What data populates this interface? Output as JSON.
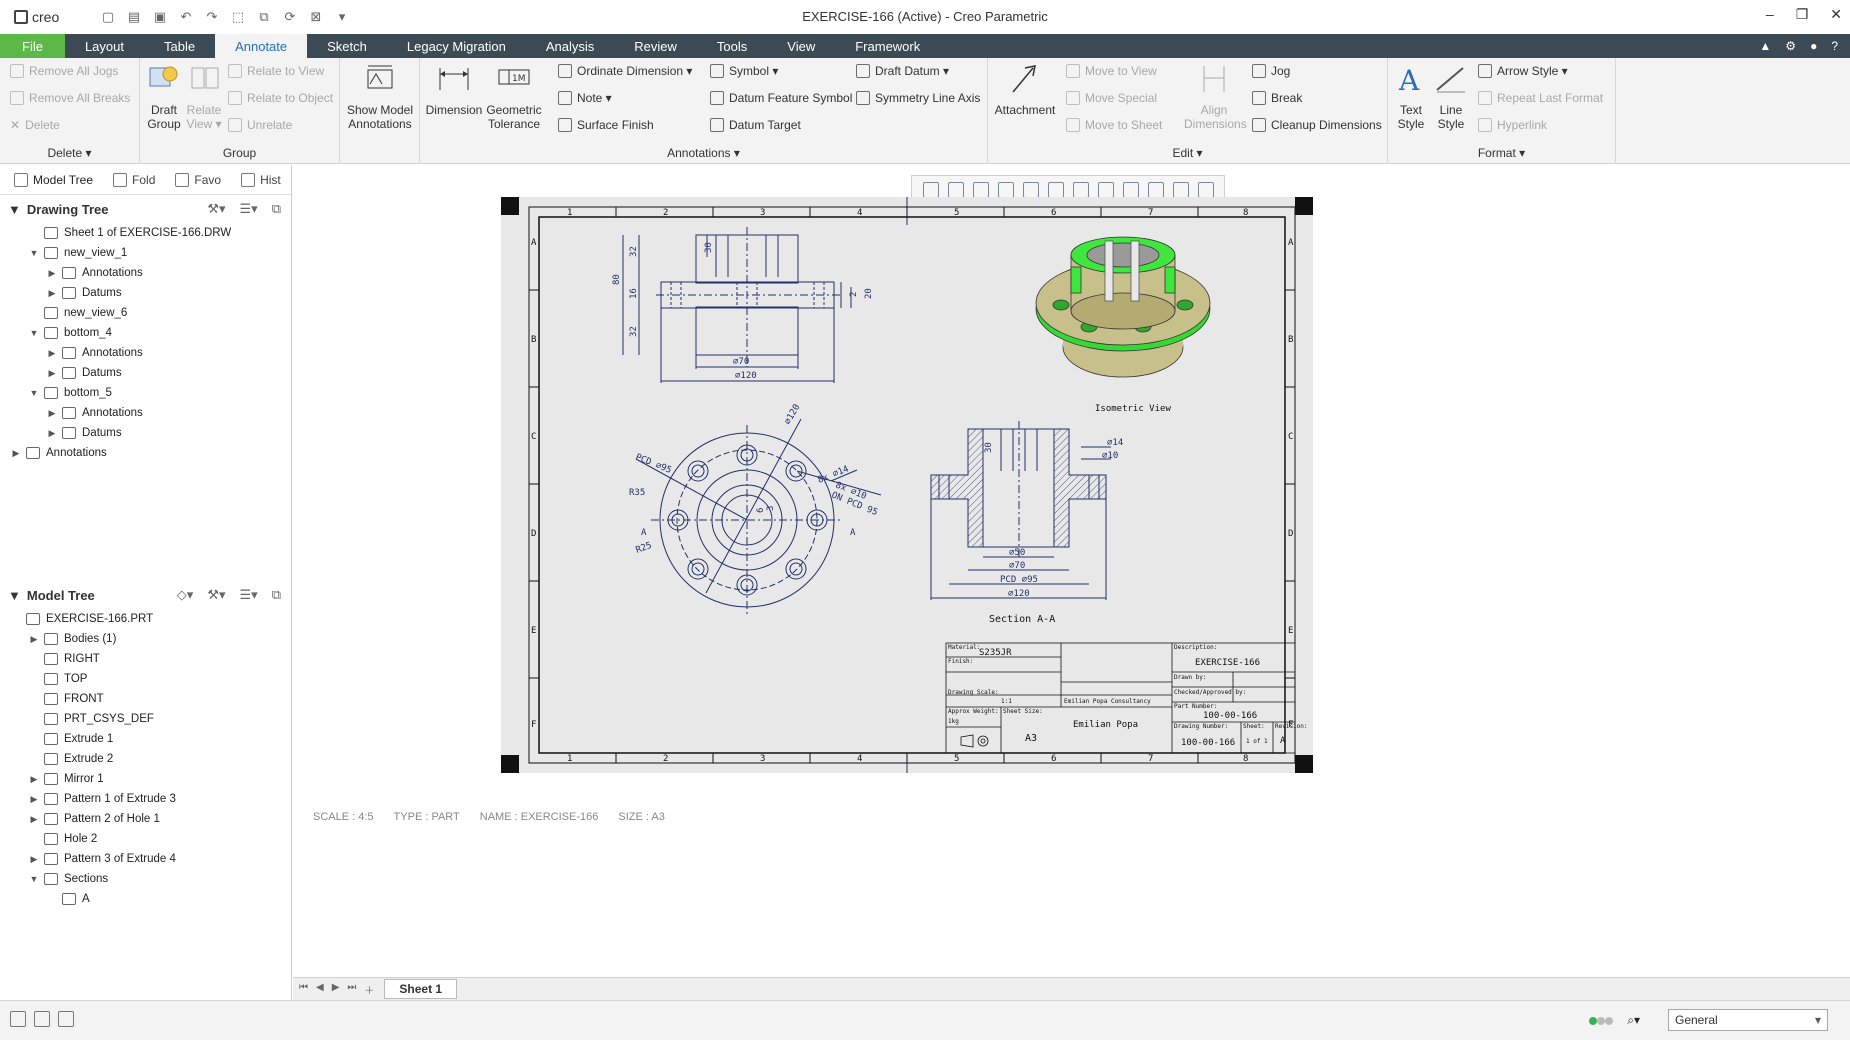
{
  "app": {
    "logo": "creo",
    "title": "EXERCISE-166 (Active) - Creo Parametric",
    "window_controls": [
      "–",
      "❐",
      "✕"
    ]
  },
  "menu": {
    "tabs": [
      "File",
      "Layout",
      "Table",
      "Annotate",
      "Sketch",
      "Legacy Migration",
      "Analysis",
      "Review",
      "Tools",
      "View",
      "Framework"
    ],
    "active": "Annotate",
    "right_icons": [
      "▲",
      "⚙",
      "●",
      "?"
    ]
  },
  "ribbon": {
    "delete_group": {
      "items": [
        "Remove All Jogs",
        "Remove All Breaks",
        "Delete"
      ],
      "label": "Delete ▾"
    },
    "group_group": {
      "draft_group": "Draft\nGroup",
      "relate_view": "Relate\nView ▾",
      "items": [
        "Relate to View",
        "Relate to Object",
        "Unrelate"
      ],
      "label": "Group"
    },
    "show_model_annotations": "Show Model\nAnnotations",
    "annotations_group": {
      "dimension": "Dimension",
      "geometric_tolerance": "Geometric\nTolerance",
      "col1": [
        "Ordinate Dimension ▾",
        "Note ▾",
        "Surface Finish"
      ],
      "col2": [
        "Symbol ▾",
        "Datum Feature Symbol",
        "Datum Target"
      ],
      "col3": [
        "Draft Datum ▾",
        "Symmetry Line Axis"
      ],
      "label": "Annotations ▾"
    },
    "edit_group": {
      "attachment": "Attachment",
      "col1": [
        "Move to View",
        "Move Special",
        "Move to Sheet"
      ],
      "align_dimensions": "Align\nDimensions",
      "col2": [
        "Jog",
        "Break",
        "Cleanup Dimensions"
      ],
      "label": "Edit ▾"
    },
    "format_group": {
      "text_style": "Text\nStyle",
      "line_style": "Line\nStyle",
      "col1": [
        "Arrow Style ▾",
        "Repeat Last Format",
        "Hyperlink"
      ],
      "label": "Format ▾"
    }
  },
  "left_panel": {
    "tabs": [
      "Model Tree",
      "Fold",
      "Favo",
      "Hist"
    ],
    "drawing_tree": {
      "title": "Drawing Tree",
      "items": [
        {
          "label": "Sheet 1 of EXERCISE-166.DRW",
          "level": 0,
          "arrow": ""
        },
        {
          "label": "new_view_1",
          "level": 0,
          "arrow": "▼"
        },
        {
          "label": "Annotations",
          "level": 1,
          "arrow": "▶"
        },
        {
          "label": "Datums",
          "level": 1,
          "arrow": "▶"
        },
        {
          "label": "new_view_6",
          "level": 0,
          "arrow": ""
        },
        {
          "label": "bottom_4",
          "level": 0,
          "arrow": "▼"
        },
        {
          "label": "Annotations",
          "level": 1,
          "arrow": "▶"
        },
        {
          "label": "Datums",
          "level": 1,
          "arrow": "▶"
        },
        {
          "label": "bottom_5",
          "level": 0,
          "arrow": "▼"
        },
        {
          "label": "Annotations",
          "level": 1,
          "arrow": "▶"
        },
        {
          "label": "Datums",
          "level": 1,
          "arrow": "▶"
        },
        {
          "label": "Annotations",
          "level": -1,
          "arrow": "▶"
        }
      ]
    },
    "model_tree": {
      "title": "Model Tree",
      "items": [
        {
          "label": "EXERCISE-166.PRT",
          "level": -1,
          "arrow": ""
        },
        {
          "label": "Bodies (1)",
          "level": 0,
          "arrow": "▶"
        },
        {
          "label": "RIGHT",
          "level": 0,
          "arrow": ""
        },
        {
          "label": "TOP",
          "level": 0,
          "arrow": ""
        },
        {
          "label": "FRONT",
          "level": 0,
          "arrow": ""
        },
        {
          "label": "PRT_CSYS_DEF",
          "level": 0,
          "arrow": ""
        },
        {
          "label": "Extrude 1",
          "level": 0,
          "arrow": ""
        },
        {
          "label": "Extrude 2",
          "level": 0,
          "arrow": ""
        },
        {
          "label": "Mirror 1",
          "level": 0,
          "arrow": "▶"
        },
        {
          "label": "Pattern 1 of Extrude 3",
          "level": 0,
          "arrow": "▶"
        },
        {
          "label": "Pattern 2 of Hole 1",
          "level": 0,
          "arrow": "▶"
        },
        {
          "label": "Hole 2",
          "level": 0,
          "arrow": ""
        },
        {
          "label": "Pattern 3 of Extrude 4",
          "level": 0,
          "arrow": "▶"
        },
        {
          "label": "Sections",
          "level": 0,
          "arrow": "▼"
        },
        {
          "label": "A",
          "level": 1,
          "arrow": ""
        }
      ]
    }
  },
  "drawing": {
    "zone_cols": [
      "1",
      "2",
      "3",
      "4",
      "5",
      "6",
      "7",
      "8"
    ],
    "zone_rows": [
      "A",
      "B",
      "C",
      "D",
      "E",
      "F"
    ],
    "front_dims": {
      "d80": "80",
      "d32a": "32",
      "d16": "16",
      "d32b": "32",
      "d30": "30",
      "d2": "2",
      "d20": "20",
      "dia70": "⌀70",
      "dia120": "⌀120"
    },
    "top_dims": {
      "dia120": "⌀120",
      "pcd95": "PCD ⌀95",
      "dia14": "8x ⌀14",
      "dia10": "8x ⌀10",
      "on_pcd": "ON PCD 95",
      "r35": "R35",
      "r25": "R25",
      "d6": "6",
      "d3": "3",
      "a1": "A",
      "a2": "A"
    },
    "section_dims": {
      "d30": "30",
      "dia14": "⌀14",
      "dia10": "⌀10",
      "dia50": "⌀50",
      "dia70": "⌀70",
      "pcd95": "PCD ⌀95",
      "dia120": "⌀120"
    },
    "iso_label": "Isometric View",
    "section_label": "Section A-A",
    "title_block": {
      "material_hdr": "Material:",
      "material": "S235JR",
      "finish_hdr": "Finish:",
      "title_hdr": "Description:",
      "title": "EXERCISE-166",
      "drawn_by_hdr": "Drawn by:",
      "approved_hdr": "Checked/Approved by:",
      "scale_hdr": "Drawing Scale:",
      "scale": "1:1",
      "company": "Emilian Popa Consultancy",
      "author": "Emilian Popa",
      "weight_hdr": "Approx Weight:",
      "weight": "1kg",
      "sheet_size_hdr": "Sheet Size:",
      "sheet_size": "A3",
      "part_no_hdr": "Part Number:",
      "part_no": "100-00-166",
      "drawing_no_hdr": "Drawing Number:",
      "drawing_no": "100-00-166",
      "sheet_hdr": "Sheet:",
      "sheet": "1 of 1",
      "revision_hdr": "Revision:",
      "revision": "A"
    }
  },
  "status_line": [
    "SCALE : 4:5",
    "TYPE : PART",
    "NAME : EXERCISE-166",
    "SIZE : A3"
  ],
  "sheet_tab": "Sheet 1",
  "filter": "General",
  "colors": {
    "menubar": "#3c4a55",
    "file_tab": "#5cb847",
    "drawing_line": "#22306b",
    "model_green": "#3ee63e",
    "model_body": "#c8c08a"
  }
}
